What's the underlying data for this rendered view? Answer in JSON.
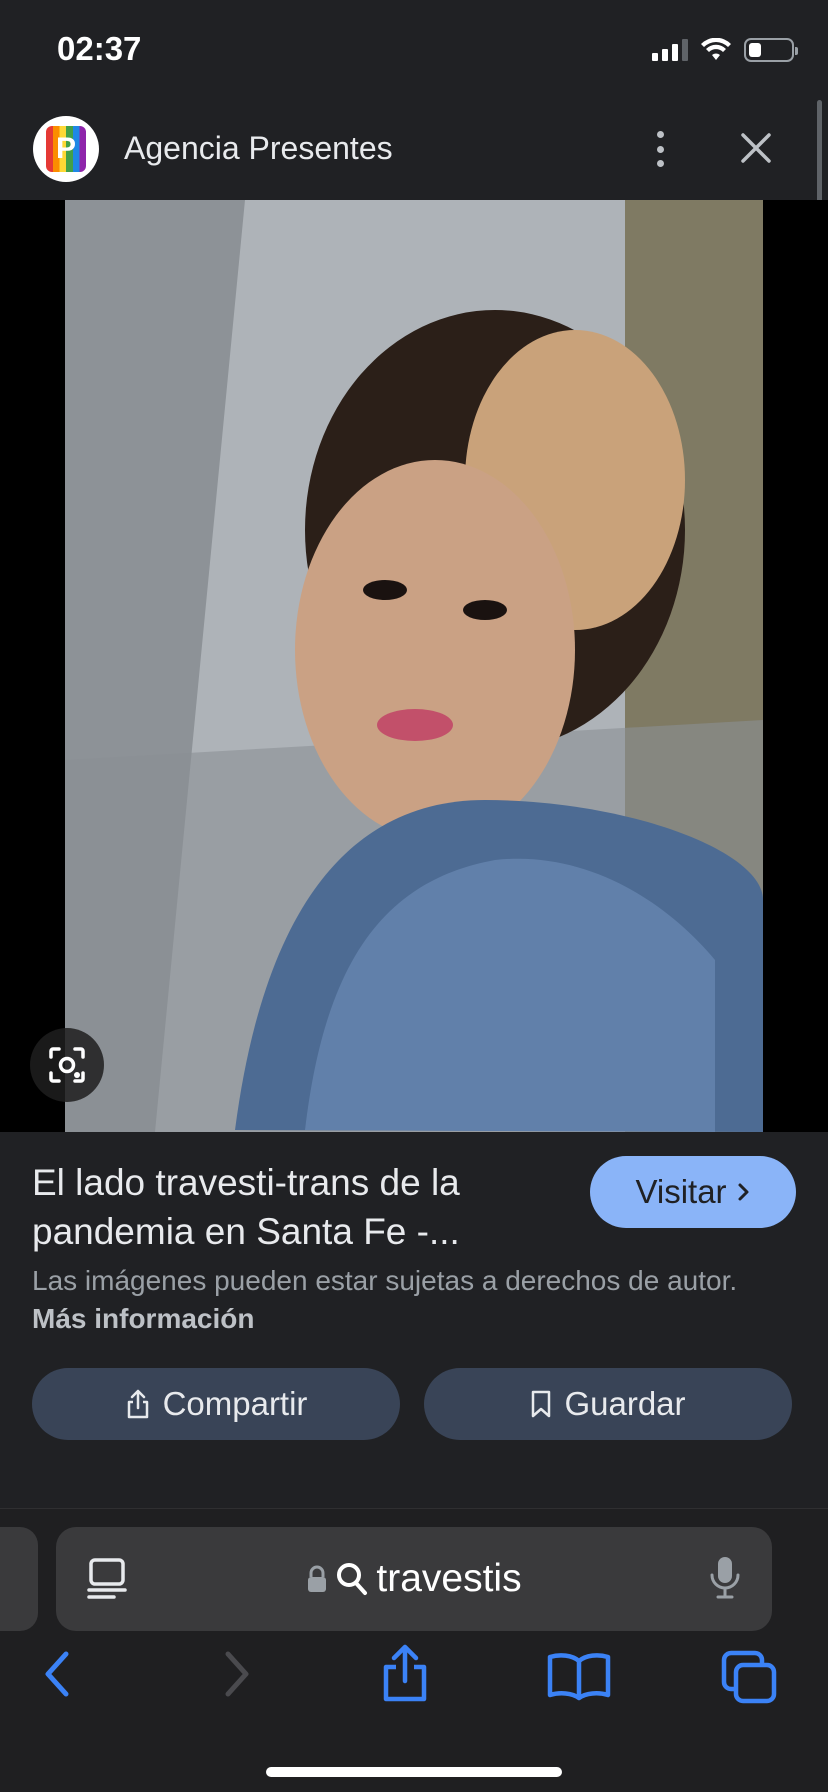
{
  "status": {
    "time": "02:37"
  },
  "header": {
    "site_name": "Agencia Presentes",
    "logo_letter": "P"
  },
  "result": {
    "title": "El lado travesti-trans de la pandemia en Santa Fe -...",
    "visit_label": "Visitar",
    "rights_text": "Las imágenes pueden estar sujetas a derechos de autor.",
    "more_info_label": "Más información",
    "share_label": "Compartir",
    "save_label": "Guardar"
  },
  "browser": {
    "query": "travestis"
  },
  "colors": {
    "accent": "#8ab4f8",
    "button_bg": "#394457",
    "safari_blue": "#3b82f6"
  },
  "icons": [
    "signal-icon",
    "wifi-icon",
    "battery-icon",
    "more-vert-icon",
    "close-icon",
    "lens-icon",
    "chevron-right-icon",
    "share-icon",
    "bookmark-icon",
    "reader-icon",
    "lock-icon",
    "search-icon",
    "mic-icon",
    "back-icon",
    "forward-icon",
    "tabs-icon"
  ]
}
